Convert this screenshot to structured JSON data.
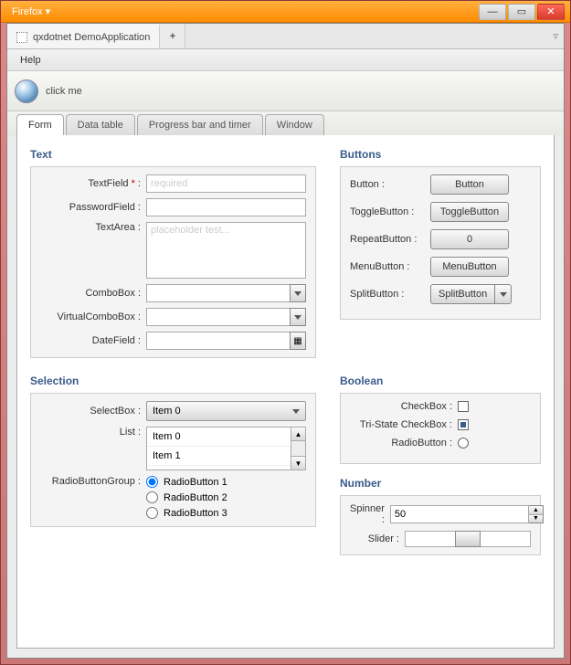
{
  "window": {
    "browser": "Firefox ▾"
  },
  "browser_tab": {
    "title": "qxdotnet DemoApplication"
  },
  "menubar": {
    "help": "Help"
  },
  "toolbar": {
    "click_me": "click me"
  },
  "apptabs": {
    "form": "Form",
    "data_table": "Data table",
    "progress": "Progress bar and timer",
    "window": "Window"
  },
  "text": {
    "title": "Text",
    "textfield_label": "TextField",
    "textfield_placeholder": "required",
    "password_label": "PasswordField :",
    "textarea_label": "TextArea :",
    "textarea_placeholder": "placeholder test...",
    "combobox_label": "ComboBox :",
    "virtualcombobox_label": "VirtualComboBox :",
    "datefield_label": "DateField :"
  },
  "buttons": {
    "title": "Buttons",
    "button_label": "Button :",
    "button_text": "Button",
    "toggle_label": "ToggleButton :",
    "toggle_text": "ToggleButton",
    "repeat_label": "RepeatButton :",
    "repeat_text": "0",
    "menu_label": "MenuButton :",
    "menu_text": "MenuButton",
    "split_label": "SplitButton :",
    "split_text": "SplitButton"
  },
  "selection": {
    "title": "Selection",
    "selectbox_label": "SelectBox :",
    "selectbox_value": "Item 0",
    "list_label": "List :",
    "list_items": [
      "Item 0",
      "Item 1"
    ],
    "rbg_label": "RadioButtonGroup :",
    "radios": [
      "RadioButton 1",
      "RadioButton 2",
      "RadioButton 3"
    ]
  },
  "boolean": {
    "title": "Boolean",
    "checkbox_label": "CheckBox :",
    "tri_label": "Tri-State CheckBox :",
    "radio_label": "RadioButton :"
  },
  "number": {
    "title": "Number",
    "spinner_label": "Spinner :",
    "spinner_value": "50",
    "slider_label": "Slider :"
  }
}
